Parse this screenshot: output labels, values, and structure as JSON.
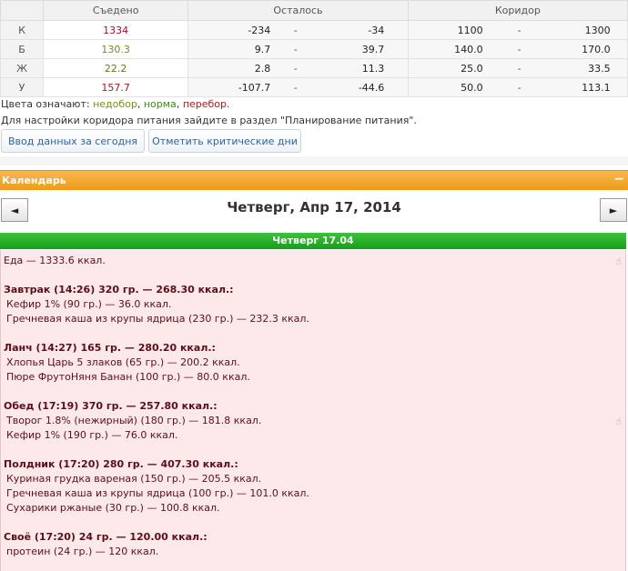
{
  "table": {
    "headers": [
      "",
      "Съедено",
      "Осталось",
      "Коридор"
    ],
    "rows": [
      {
        "label": "К",
        "eaten": "1334",
        "rem_a": "-234",
        "rem_dash": "-",
        "rem_b": "-34",
        "cor_a": "1100",
        "cor_dash": "-",
        "cor_b": "1300"
      },
      {
        "label": "Б",
        "eaten": "130.3",
        "rem_a": "9.7",
        "rem_dash": "-",
        "rem_b": "39.7",
        "cor_a": "140.0",
        "cor_dash": "-",
        "cor_b": "170.0"
      },
      {
        "label": "Ж",
        "eaten": "22.2",
        "rem_a": "2.8",
        "rem_dash": "-",
        "rem_b": "11.3",
        "cor_a": "25.0",
        "cor_dash": "-",
        "cor_b": "33.5"
      },
      {
        "label": "У",
        "eaten": "157.7",
        "rem_a": "-107.7",
        "rem_dash": "-",
        "rem_b": "-44.6",
        "cor_a": "50.0",
        "cor_dash": "-",
        "cor_b": "113.1"
      }
    ]
  },
  "legend": {
    "prefix": "Цвета означают: ",
    "under": "недобор",
    "sep1": ", ",
    "norm": "норма",
    "sep2": ", ",
    "over": "перебор",
    "end": "."
  },
  "note": "Для настройки коридора питания зайдите в раздел \"Планирование питания\".",
  "buttons": {
    "enter_today": "Ввод данных за сегодня",
    "mark_critical": "Отметить критические дни"
  },
  "calendar": {
    "title": "Календарь",
    "collapse": "−",
    "prev": "◄",
    "next": "►",
    "date": "Четверг, Апр 17, 2014",
    "day_label": "Четверг 17.04"
  },
  "diary": {
    "total": "Еда — 1333.6 ккал.",
    "meals": [
      {
        "title": "Завтрак (14:26) 320 гр. — 268.30 ккал.:",
        "items": [
          "Кефир 1% (90 гр.) — 36.0 ккал.",
          "Гречневая каша из крупы ядрица (230 гр.) — 232.3 ккал."
        ]
      },
      {
        "title": "Ланч (14:27) 165 гр. — 280.20 ккал.:",
        "items": [
          "Хлопья Царь 5 злаков (65 гр.) — 200.2 ккал.",
          "Пюре ФрутоНяня Банан (100 гр.) — 80.0 ккал."
        ]
      },
      {
        "title": "Обед (17:19) 370 гр. — 257.80 ккал.:",
        "items": [
          "Творог 1.8% (нежирный) (180 гр.) — 181.8 ккал.",
          "Кефир 1% (190 гр.) — 76.0 ккал."
        ]
      },
      {
        "title": "Полдник (17:20) 280 гр. — 407.30 ккал.:",
        "items": [
          "Куриная грудка вареная (150 гр.) — 205.5 ккал.",
          "Гречневая каша из крупы ядрица (100 гр.) — 101.0 ккал.",
          "Сухарики ржаные (30 гр.) — 100.8 ккал."
        ]
      },
      {
        "title": "Своё (17:20) 24 гр. — 120.00 ккал.:",
        "items": [
          "протеин (24 гр.) — 120 ккал."
        ]
      }
    ]
  }
}
